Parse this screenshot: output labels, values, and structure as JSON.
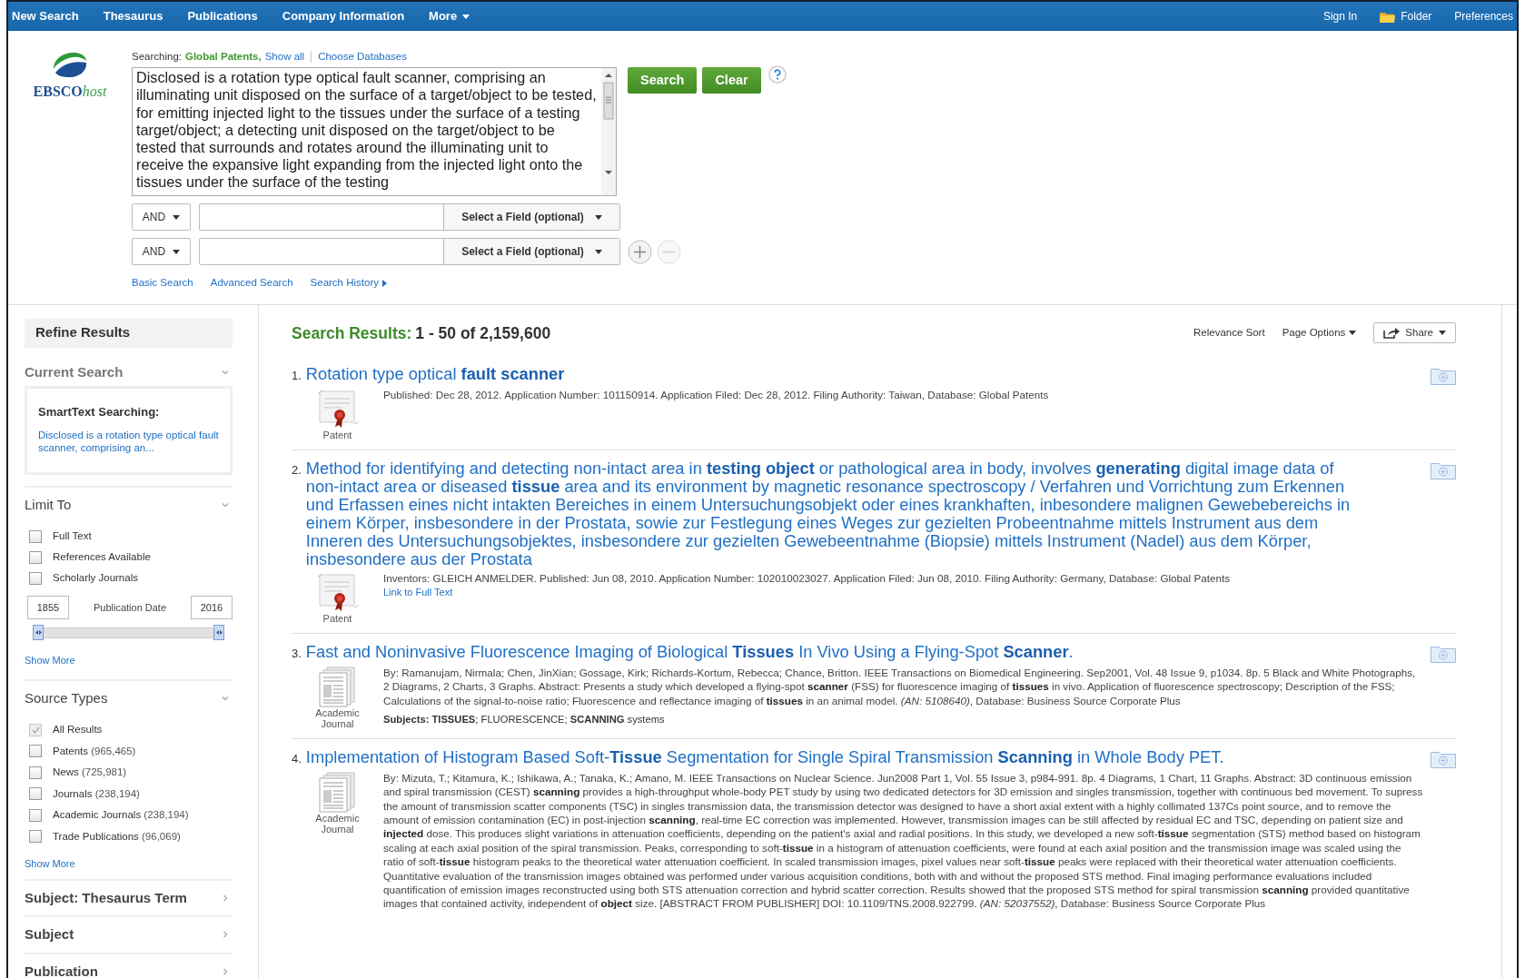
{
  "nav": {
    "left": [
      {
        "label": "New Search",
        "caret": false
      },
      {
        "label": "Thesaurus",
        "caret": false
      },
      {
        "label": "Publications",
        "caret": false
      },
      {
        "label": "Company Information",
        "caret": false
      },
      {
        "label": "More",
        "caret": true
      }
    ],
    "right": [
      {
        "label": "Sign In",
        "kind": "link"
      },
      {
        "label": "Folder",
        "kind": "folder"
      },
      {
        "label": "Preferences",
        "kind": "link"
      }
    ]
  },
  "logo": {
    "brand": "EBSCO",
    "suffix": "host"
  },
  "search": {
    "searching_label": "Searching:",
    "databases": "Global Patents,",
    "show_all": "Show all",
    "choose": "Choose Databases",
    "query": "Disclosed is a rotation type optical fault scanner, comprising an illuminating unit disposed on the surface of a target/object to be tested, for emitting injected light to the tissues under the surface of a testing target/object; a detecting unit disposed on the target/object to be tested that surrounds and rotates around the illuminating unit to receive the expansive light expanding from the injected light onto the tissues under the surface of the testing",
    "buttons": [
      "Search",
      "Clear"
    ],
    "rows": [
      {
        "operator": "AND",
        "field": "Select a Field (optional)",
        "controls": false
      },
      {
        "operator": "AND",
        "field": "Select a Field (optional)",
        "controls": true
      }
    ],
    "links": [
      {
        "label": "Basic Search",
        "arrow": false
      },
      {
        "label": "Advanced Search",
        "arrow": false
      },
      {
        "label": "Search History",
        "arrow": true
      }
    ]
  },
  "sidebar": {
    "title": "Refine Results",
    "sections": [
      {
        "kind": "current",
        "title": "Current Search",
        "expanded": true,
        "heading": "SmartText Searching:",
        "text": "Disclosed is a rotation type optical fault scanner, comprising an..."
      },
      {
        "kind": "limits",
        "title": "Limit To",
        "expanded": true,
        "options": [
          {
            "label": "Full Text",
            "checked": false
          },
          {
            "label": "References Available",
            "checked": false
          },
          {
            "label": "Scholarly Journals",
            "checked": false
          }
        ],
        "date": {
          "from": "1855",
          "label": "Publication Date",
          "to": "2016",
          "level": 1
        },
        "show_more": "Show More"
      },
      {
        "kind": "sources",
        "title": "Source Types",
        "expanded": true,
        "options": [
          {
            "label": "All Results",
            "checked": true
          },
          {
            "label": "Patents",
            "count": "(965,465)",
            "checked": false
          },
          {
            "label": "News",
            "count": "(725,981)",
            "checked": false
          },
          {
            "label": "Journals",
            "count": "(238,194)",
            "checked": false
          },
          {
            "label": "Academic Journals",
            "count": "(238,194)",
            "checked": false
          },
          {
            "label": "Trade Publications",
            "count": "(96,069)",
            "checked": false
          }
        ],
        "show_more": "Show More"
      },
      {
        "kind": "plain",
        "title": "Subject: Thesaurus Term",
        "expanded": false
      },
      {
        "kind": "plain",
        "title": "Subject",
        "expanded": false
      },
      {
        "kind": "plain",
        "title": "Publication",
        "expanded": false
      }
    ]
  },
  "results": {
    "heading": "Search Results:",
    "range": "1 - 50 of 2,159,600",
    "sort": "Relevance Sort",
    "page_options": "Page Options",
    "share": "Share",
    "items": [
      {
        "number": "1.",
        "kind": "patent",
        "type_label": "Patent",
        "title": "Rotation type optical **fault scanner**",
        "details": [
          "Published: Dec 28, 2012. Application Number: 101150914. Application Filed: Dec 28, 2012. Filing Authority: Taiwan, Database: Global Patents"
        ]
      },
      {
        "number": "2.",
        "kind": "patent",
        "type_label": "Patent",
        "title": "Method for identifying and detecting non-intact area in **testing object** or pathological area in body, involves **generating** digital image data of non-intact area or diseased **tissue** area and its environment by magnetic resonance spectroscopy / Verfahren und Vorrichtung zum Erkennen und Erfassen eines nicht intakten Bereiches in einem Untersuchungsobjekt oder eines krankhaften, inbesondere malignen Gewebebereichs in einem Körper, insbesondere in der Prostata, sowie zur Festlegung eines Weges zur gezielten Probeentnahme mittels Instrument aus dem Inneren des Untersuchungsobjektes, insbesondere zur gezielten Gewebeentnahme (Biopsie) mittels Instrument (Nadel) aus dem Körper, insbesondere aus der Prostata",
        "details": [
          "Inventors: GLEICH ANMELDER. Published: Jun 08, 2010. Application Number: 102010023027. Application Filed: Jun 08, 2010. Filing Authority: Germany, Database: Global Patents"
        ],
        "link": "Link to Full Text"
      },
      {
        "number": "3.",
        "kind": "journal",
        "type_label": "Academic Journal",
        "title": "Fast and Noninvasive Fluorescence Imaging of Biological **Tissues** In Vivo Using a Flying-Spot **Scanner**.",
        "details": [
          "By: Ramanujam, Nirmala; Chen, JinXian; Gossage, Kirk; Richards-Kortum, Rebecca; Chance, Britton. IEEE Transactions on Biomedical Engineering. Sep2001, Vol. 48 Issue 9, p1034. 8p. 5 Black and White Photographs, 2 Diagrams, 2 Charts, 3 Graphs. Abstract: Presents a study which developed a flying-spot **scanner** (FSS) for fluorescence imaging of **tissues** in vivo. Application of fluorescence spectroscopy; Description of the FSS; Calculations of the signal-to-noise ratio; Fluorescence and reflectance imaging of **tissues** in an animal model. *(AN: 5108640)*, Database: Business Source Corporate Plus"
        ],
        "subjects": "**Subjects: TISSUES**; FLUORESCENCE; **SCANNING** systems"
      },
      {
        "number": "4.",
        "kind": "journal",
        "type_label": "Academic Journal",
        "title": "Implementation of Histogram Based Soft-**Tissue** Segmentation for Single Spiral Transmission **Scanning** in Whole Body PET.",
        "details": [
          "By: Mizuta, T.; Kitamura, K.; Ishikawa, A.; Tanaka, K.; Amano, M. IEEE Transactions on Nuclear Science. Jun2008 Part 1, Vol. 55 Issue 3, p984-991. 8p. 4 Diagrams, 1 Chart, 11 Graphs. Abstract: 3D continuous emission and spiral transmission (CEST) **scanning** provides a high-throughput whole-body PET study by using two dedicated detectors for 3D emission and singles transmission, together with continuous bed movement. To supress the amount of transmission scatter components (TSC) in singles transmission data, the transmission detector was designed to have a short axial extent with a highly collimated 137Cs point source, and to remove the amount of emission contamination (EC) in post-injection **scanning**, real-time EC correction was implemented. However, transmission images can be still affected by residual EC and TSC, depending on patient size and **injected** dose. This produces slight variations in attenuation coefficients, depending on the patient's axial and radial positions. In this study, we developed a new soft-**tissue** segmentation (STS) method based on histogram scaling at each axial position of the spiral transmission. Peaks, corresponding to soft-**tissue** in a histogram of attenuation coefficients, were found at each axial position and the transmission image was scaled using the ratio of soft-**tissue** histogram peaks to the theoretical water attenuation coefficient. In scaled transmission images, pixel values near soft-**tissue** peaks were replaced with their theoretical water attenuation coefficients. Quantitative evaluation of the transmission images obtained was performed under various acquisition conditions, both with and without the proposed STS method. Final imaging performance evaluations included quantification of emission images reconstructed using both STS attenuation correction and hybrid scatter correction. Results showed that the proposed STS method for spiral transmission **scanning** provided quantitative images that contained activity, independent of **object** size. [ABSTRACT FROM PUBLISHER] DOI: 10.1109/TNS.2008.922799. *(AN: 52037552)*, Database: Business Source Corporate Plus"
        ]
      }
    ]
  }
}
